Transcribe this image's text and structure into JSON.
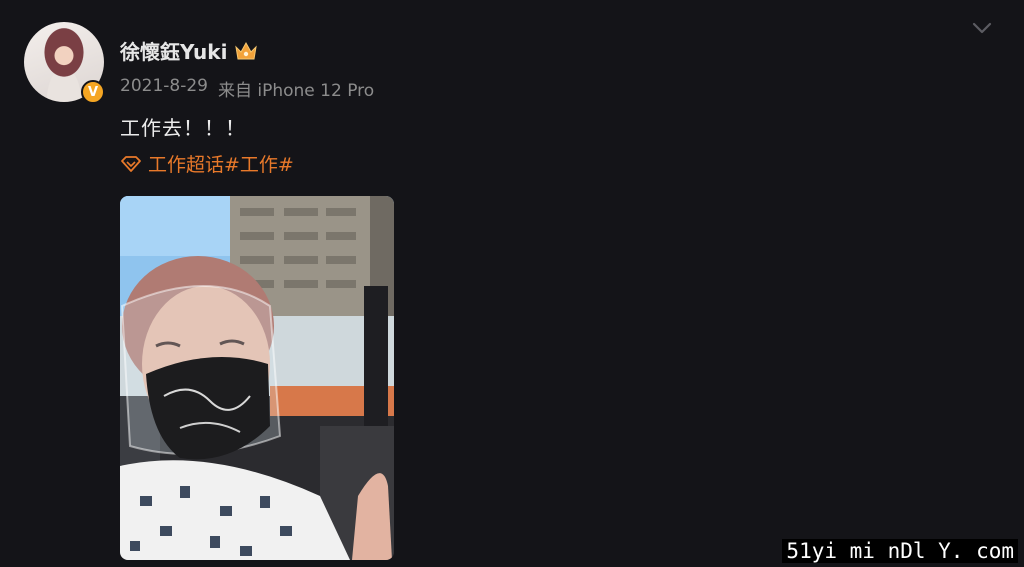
{
  "post": {
    "username": "徐懷鈺Yuki",
    "date": "2021-8-29",
    "source": "来自 iPhone 12 Pro",
    "text": "工作去！！！",
    "topic": "工作超话#工作#",
    "verified_badge": "V",
    "photo": {
      "description_icon": "selfie-photo"
    }
  },
  "icons": {
    "crown": "crown-icon",
    "diamond": "diamond-icon",
    "chevron": "chevron-down-icon"
  },
  "watermark": "51yi mi nDl Y. com",
  "colors": {
    "background": "#141418",
    "topic": "#e8792a",
    "verified": "#f5a623"
  }
}
